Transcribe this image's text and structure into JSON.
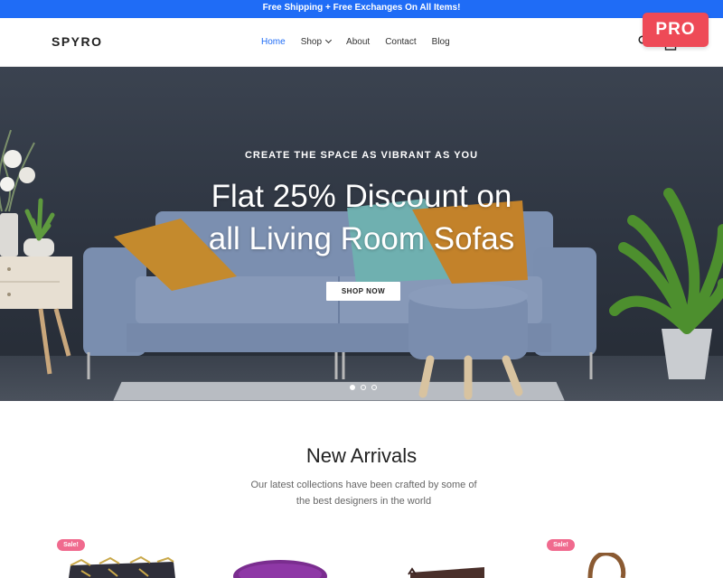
{
  "announcement": "Free Shipping + Free Exchanges On All Items!",
  "brand": "SPYRO",
  "nav": {
    "items": [
      {
        "label": "Home",
        "active": true
      },
      {
        "label": "Shop",
        "has_dropdown": true
      },
      {
        "label": "About"
      },
      {
        "label": "Contact"
      },
      {
        "label": "Blog"
      }
    ]
  },
  "header_icons": [
    "search-icon",
    "cart-icon"
  ],
  "pro_badge": "PRO",
  "hero": {
    "eyebrow": "CREATE THE SPACE AS VIBRANT AS YOU",
    "title_line1": "Flat 25% Discount on",
    "title_line2": "all Living Room Sofas",
    "button": "SHOP NOW",
    "slides": 3,
    "active_slide": 1
  },
  "new_arrivals": {
    "title": "New Arrivals",
    "subtitle_line1": "Our latest collections have been crafted by some of",
    "subtitle_line2": "the best designers in the world"
  },
  "products": [
    {
      "badge": "Sale!"
    },
    {
      "badge": ""
    },
    {
      "badge": ""
    },
    {
      "badge": "Sale!"
    }
  ],
  "colors": {
    "accent": "#1f6cf6",
    "pro": "#ee4a57",
    "sale": "#f06a8e"
  }
}
